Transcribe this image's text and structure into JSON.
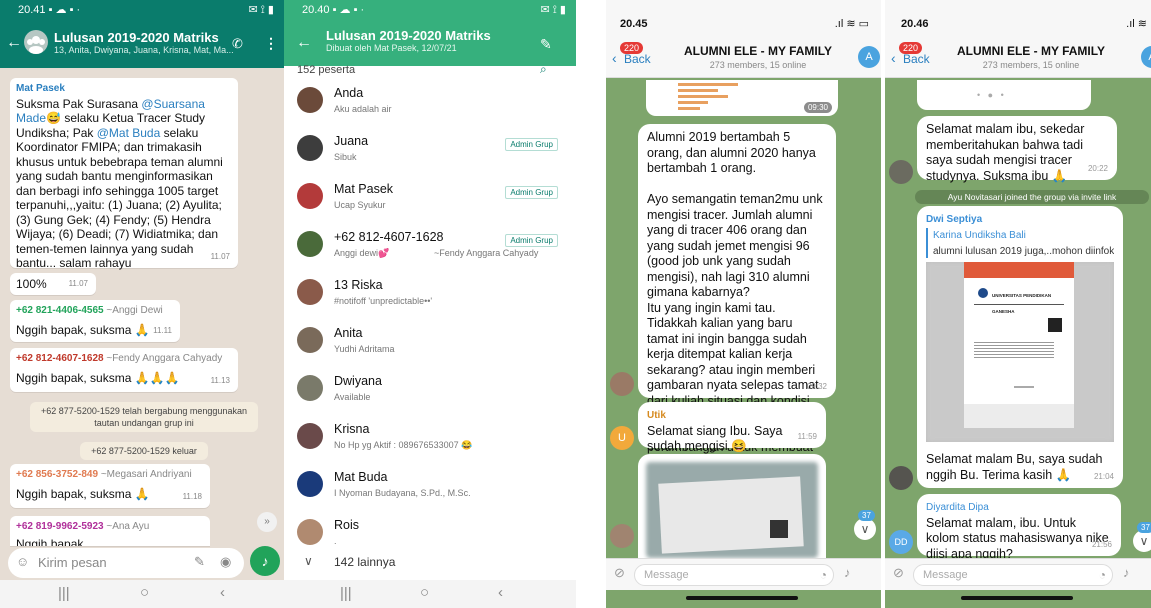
{
  "wa_chat": {
    "status_time": "20.41",
    "group_title": "Lulusan 2019-2020 Matriks",
    "group_members": "13, Anita, Dwiyana, Juana, Krisna, Mat, Ma...",
    "msg1": {
      "sender": "Mat Pasek",
      "text_a": "Suksma Pak Surasana ",
      "mention1": "@Suarsana Made",
      "emoji1": "😅",
      "text_b": " selaku Ketua Tracer Study Undiksha; Pak ",
      "mention2": "@Mat Buda",
      "text_c": " selaku Koordinator FMIPA; dan trimakasih khusus untuk bebebrapa teman alumni yang sudah bantu menginformasikan dan berbagi info sehingga 1005 target terpanuhi,,,yaitu: (1) Juana; (2) Ayulita; (3) Gung Gek; (4) Fendy; (5) Hendra Wijaya; (6) Deadi; (7) Widiatmika; dan temen-temen lainnya yang sudah bantu... salam rahayu",
      "time": "11.07"
    },
    "msg2": {
      "text": "100%",
      "time": "11.07"
    },
    "msg3": {
      "number": "+62 821-4406-4565",
      "name": "~Anggi Dewi",
      "text": "Nggih bapak, suksma",
      "emoji": "🙏",
      "time": "11.11"
    },
    "msg4": {
      "number": "+62 812-4607-1628",
      "name": "~Fendy Anggara Cahyady",
      "text": "Nggih bapak, suksma",
      "emoji": "🙏🙏🙏",
      "time": "11.13"
    },
    "sys1": "+62 877-5200-1529 telah bergabung menggunakan tautan undangan grup ini",
    "sys2": "+62 877-5200-1529 keluar",
    "msg5": {
      "number": "+62 856-3752-849",
      "name": "~Megasari Andriyani",
      "text": "Nggih bapak, suksma",
      "emoji": "🙏",
      "time": "11.18"
    },
    "msg6": {
      "number": "+62 819-9962-5923",
      "name": "~Ana Ayu",
      "text": "Nggih bapak"
    },
    "input_placeholder": "Kirim pesan"
  },
  "wa_info": {
    "status_time": "20.40",
    "group_title": "Lulusan 2019-2020 Matriks",
    "created": "Dibuat oleh Mat Pasek, 12/07/21",
    "participants": "152 peserta",
    "admin_label": "Admin Grup",
    "members": [
      {
        "name": "Anda",
        "status": "Aku adalah air",
        "admin": false,
        "color": "#6b4a3a"
      },
      {
        "name": "Juana",
        "status": "Sibuk",
        "admin": true,
        "color": "#3d3d3d"
      },
      {
        "name": "Mat Pasek",
        "status": "Ucap Syukur",
        "admin": true,
        "color": "#b33a3a"
      },
      {
        "name": "+62 812-4607-1628",
        "status": "Anggi dewi💕",
        "extra": "~Fendy Anggara Cahyady",
        "admin": true,
        "color": "#4a6a3a"
      },
      {
        "name": "13 Riska",
        "status": "#notifoff 'unpredictable••'",
        "admin": false,
        "color": "#8a5a4a"
      },
      {
        "name": "Anita",
        "status": "Yudhi Adritama",
        "admin": false,
        "color": "#7a6a5a"
      },
      {
        "name": "Dwiyana",
        "status": "Available",
        "admin": false,
        "color": "#7a7a6a"
      },
      {
        "name": "Krisna",
        "status": "No Hp yg Aktif : 089676533007 😂",
        "admin": false,
        "color": "#6a4a4a"
      },
      {
        "name": "Mat Buda",
        "status": "I Nyoman Budayana, S.Pd., M.Sc.",
        "admin": false,
        "color": "#1a3a7a"
      },
      {
        "name": "Rois",
        "status": ".",
        "admin": false,
        "color": "#b08a70"
      }
    ],
    "more": "142 lainnya"
  },
  "tg1": {
    "status_time": "20.45",
    "back_badge": "220",
    "back_label": "Back",
    "title": "ALUMNI ELE - MY FAMILY",
    "subtitle": "273 members, 15 online",
    "avatar_letter": "A",
    "img_time": "09:30",
    "msg_main": "Alumni 2019 bertambah 5 orang, dan alumni 2020 hanya bertambah 1 orang.\n\nAyo semangatin teman2mu unk mengisi tracer. Jumlah alumni yang di tracer 406 orang dan yang sudah jemet mengisi 96 (good job unk yang sudah mengisi), nah lagi 310 alumni gimana kabarnya?\nItu yang ingin kami tau.\nTidakkah kalian yang baru tamat ini ingin bangga sudah kerja ditempat kalian kerja sekarang? atau ingin memberi gambaran nyata selepas tamat dari kuliah situasi dan kondisi kalian agar kampus bisa menjadikannya bahan pertimbangan untuk membuat kebijakan tertentu?",
    "main_time": "09:32",
    "msg_utik": {
      "sender": "Utik",
      "text": "Selamat siang Ibu. Saya sudah mengisi",
      "emoji": "😆",
      "time": "11:59",
      "avatar": "U"
    },
    "badge": "37",
    "input_placeholder": "Message"
  },
  "tg2": {
    "status_time": "20.46",
    "back_badge": "220",
    "back_label": "Back",
    "title": "ALUMNI ELE - MY FAMILY",
    "subtitle": "273 members, 15 online",
    "avatar_letter": "A",
    "msg1": {
      "text": "Selamat malam ibu, sekedar memberitahukan bahwa tadi saya sudah mengisi tracer studynya. Suksma ibu",
      "emoji": "🙏",
      "time": "20:22"
    },
    "join": "Ayu Novitasari joined the group via invite link",
    "msg2": {
      "sender": "Dwi Septiya",
      "reply_name": "Karina Undiksha Bali",
      "reply_text": "alumni lulusan 2019 juga,..mohon diinfok...",
      "doc_heading": "UNIVERSITAS PENDIDIKAN GANESHA",
      "text": "Selamat malam Bu, saya sudah nggih Bu. Terima kasih",
      "emoji": "🙏",
      "time": "21:04"
    },
    "msg3": {
      "sender": "Diyardita Dipa",
      "text": "Selamat malam, ibu. Untuk kolom status mahasiswanya nike diisi apa nggih?",
      "time": "21:56",
      "avatar": "DD"
    },
    "badge": "37",
    "input_placeholder": "Message"
  }
}
